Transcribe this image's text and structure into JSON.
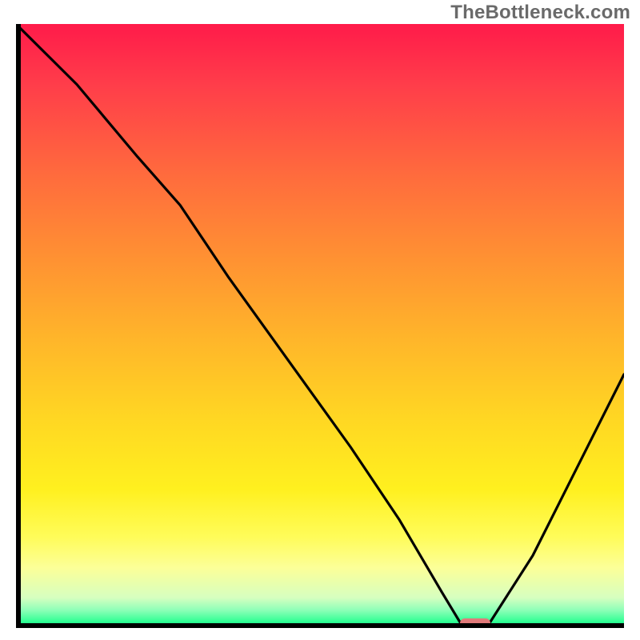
{
  "watermark": "TheBottleneck.com",
  "chart_data": {
    "type": "line",
    "title": "",
    "xlabel": "",
    "ylabel": "",
    "xlim": [
      0,
      100
    ],
    "ylim": [
      0,
      100
    ],
    "grid": false,
    "legend": false,
    "description": "Bottleneck curve over a red→green vertical gradient background. Optimal (green) region is at the bottom; curve dips to a minimum near x≈73–78 indicating the no-bottleneck point, with a small pink marker at the minimum.",
    "background_gradient": [
      {
        "stop": 0,
        "color": "#ff1b4a"
      },
      {
        "stop": 25,
        "color": "#ff6b3d"
      },
      {
        "stop": 52,
        "color": "#ffb52a"
      },
      {
        "stop": 77,
        "color": "#fff01f"
      },
      {
        "stop": 95,
        "color": "#d6ffc0"
      },
      {
        "stop": 100,
        "color": "#00e67a"
      }
    ],
    "series": [
      {
        "name": "bottleneck-curve",
        "x": [
          0,
          10,
          20,
          27,
          35,
          45,
          55,
          63,
          70,
          73,
          78,
          85,
          92,
          100
        ],
        "y": [
          100,
          90,
          78,
          70,
          58,
          44,
          30,
          18,
          6,
          1,
          1,
          12,
          26,
          42
        ]
      }
    ],
    "marker": {
      "x_start": 73,
      "x_end": 78,
      "y": 0.8,
      "color": "#e07a7a"
    }
  }
}
